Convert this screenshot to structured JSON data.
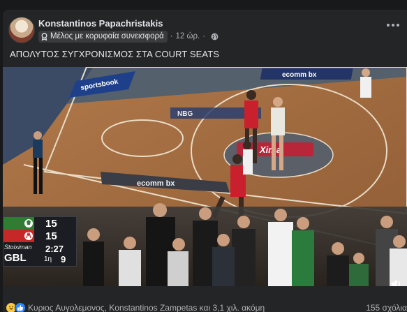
{
  "post": {
    "author": "Konstantinos Papachristakis",
    "badge_label": "Μέλος με κορυφαία συνεισφορά",
    "time_ago": "12 ώρ.",
    "separator": "·",
    "text": "ΑΠΟΛΥΤΟΣ ΣΥΓΧΡΟΝΙΣΜΟΣ ΣΤΑ COURT SEATS"
  },
  "video": {
    "court_ads": {
      "sponsor_left": "sportsbook",
      "sponsor_top": "ecomm bx",
      "sponsor_center": "NBG",
      "sponsor_mid": "ecomm bx",
      "sponsor_circle": "Xima"
    },
    "scoreboard": {
      "home_score": "15",
      "away_score": "15",
      "sponsor_mark": "Stoiximan",
      "league": "GBL",
      "clock": "2:27",
      "quarter": "1η",
      "shot_clock": "9"
    }
  },
  "footer": {
    "reactors": "Κυριος Αυγολεμονος, Konstantinos Zampetas και 3,1 χιλ. ακόμη",
    "comments": "155 σχόλια"
  },
  "icons": {
    "badge": "badge-icon",
    "globe": "globe-icon",
    "more": "more-options-icon",
    "volume": "volume-icon",
    "haha": "haha-reaction-icon",
    "like": "like-reaction-icon"
  },
  "colors": {
    "background": "#18191a",
    "card": "#242526",
    "text_primary": "#e4e6eb",
    "text_secondary": "#b0b3b8",
    "like_blue": "#2d88ff"
  }
}
